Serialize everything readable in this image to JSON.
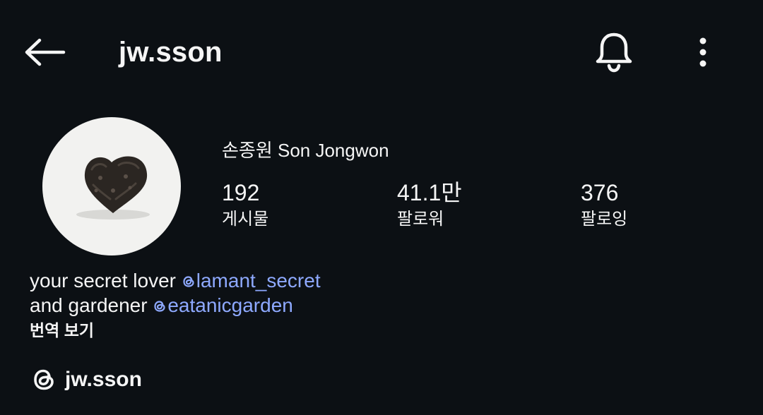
{
  "header": {
    "username": "jw.sson",
    "back_icon": "arrow-left-icon",
    "notifications_icon": "bell-icon",
    "more_icon": "more-vertical-icon"
  },
  "profile": {
    "full_name": "손종원 Son Jongwon",
    "avatar_icon": "profile-photo",
    "stats": {
      "posts": {
        "value": "192",
        "label": "게시물"
      },
      "followers": {
        "value": "41.1만",
        "label": "팔로워"
      },
      "following": {
        "value": "376",
        "label": "팔로잉"
      }
    }
  },
  "bio": {
    "line1_text": "your secret lover ",
    "line1_mention": "lamant_secret",
    "line2_text": "and gardener ",
    "line2_mention": "eatanicgarden",
    "translate_label": "번역 보기"
  },
  "threads": {
    "handle": "jw.sson",
    "icon": "threads-icon"
  },
  "colors": {
    "background": "#0c1014",
    "text": "#f5f5f5",
    "mention": "#8ea9ff",
    "avatar_bg": "#f2f2f0"
  }
}
